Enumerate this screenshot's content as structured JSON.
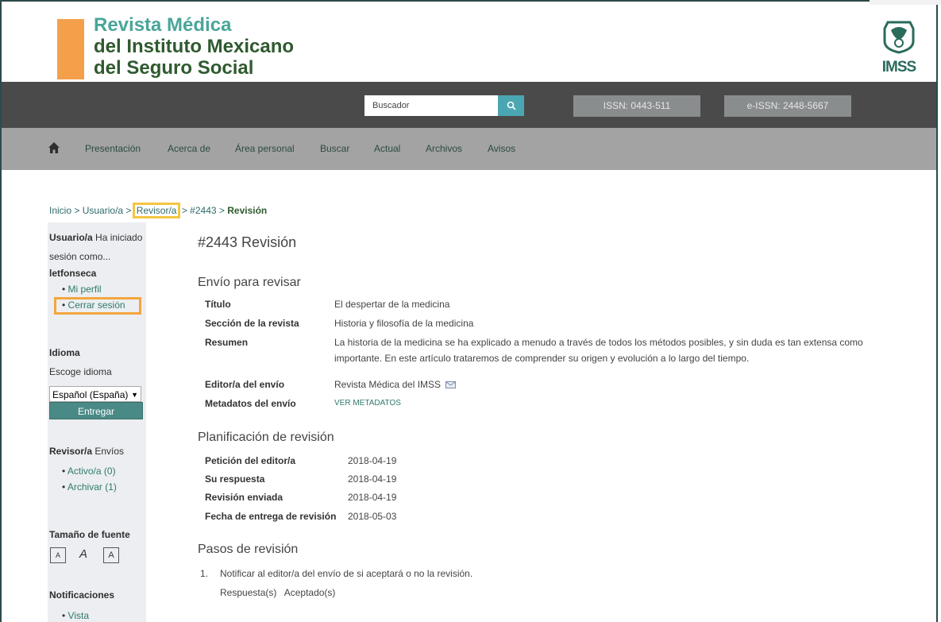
{
  "header": {
    "title_line1": "Revista Médica",
    "title_line2": "del Instituto Mexicano",
    "title_line3": "del Seguro Social",
    "logo_text": "IMSS"
  },
  "topbar": {
    "search_placeholder": "Buscador",
    "search_icon": "search-icon",
    "issn": "ISSN: 0443-511",
    "eissn": "e-ISSN: 2448-5667"
  },
  "nav": {
    "home_icon": "home-icon",
    "items": [
      "Presentación",
      "Acerca de",
      "Área personal",
      "Buscar",
      "Actual",
      "Archivos",
      "Avisos"
    ]
  },
  "breadcrumb": {
    "inicio": "Inicio",
    "usuario": "Usuario/a",
    "revisor": "Revisor/a",
    "sub": "#2443",
    "current": "Revisión",
    "sep": ">"
  },
  "sidebar": {
    "user_label": "Usuario/a",
    "logged_in_1": "Ha iniciado",
    "logged_in_2": "sesión como...",
    "username": "letfonseca",
    "mi_perfil": "Mi perfil",
    "cerrar_sesion": "Cerrar sesión",
    "idioma_title": "Idioma",
    "escoge_idioma": "Escoge idioma",
    "idioma_selected": "Español (España)",
    "entregar": "Entregar",
    "revisor_title": "Revisor/a",
    "envios": "Envíos",
    "activo": "Activo/a (0)",
    "archivar": "Archivar (1)",
    "tamano_fuente": "Tamaño de fuente",
    "font_small": "A",
    "font_medium": "A",
    "font_large": "A",
    "notificaciones": "Notificaciones",
    "vista": "Vista",
    "bullet": "•"
  },
  "main": {
    "page_title": "#2443 Revisión",
    "envio_heading": "Envío para revisar",
    "titulo_label": "Título",
    "titulo_value": "El despertar de la medicina",
    "seccion_label": "Sección de la revista",
    "seccion_value": "Historia y filosofía de la medicina",
    "resumen_label": "Resumen",
    "resumen_line1": "La historia de la medicina se ha explicado a menudo a través de todos los métodos posibles, y sin duda es tan extensa como",
    "resumen_line2": "importante. En este artículo trataremos de comprender su origen y evolución a lo largo del tiempo.",
    "editor_label": "Editor/a del envío",
    "editor_value": "Revista Médica del IMSS",
    "metadatos_label": "Metadatos del envío",
    "metadatos_link": "VER METADATOS",
    "planificacion_heading": "Planificación de revisión",
    "peticion_label": "Petición del editor/a",
    "peticion_value": "2018-04-19",
    "respuesta_label": "Su respuesta",
    "respuesta_value": "2018-04-19",
    "enviada_label": "Revisión enviada",
    "enviada_value": "2018-04-19",
    "entrega_label": "Fecha de entrega de revisión",
    "entrega_value": "2018-05-03",
    "pasos_heading": "Pasos de revisión",
    "step1_num": "1.",
    "step1_text": "Notificar al editor/a del envío de si aceptará o no la revisión.",
    "step1_resp_label": "Respuesta(s)",
    "step1_resp_value": "Aceptado(s)"
  },
  "colors": {
    "dark_bar": "#4a4a4a",
    "nav_bar": "#a3a3a3",
    "accent_teal": "#4ba6b3",
    "highlight_orange": "#f4a63e",
    "highlight_yellow": "#f5c542"
  }
}
